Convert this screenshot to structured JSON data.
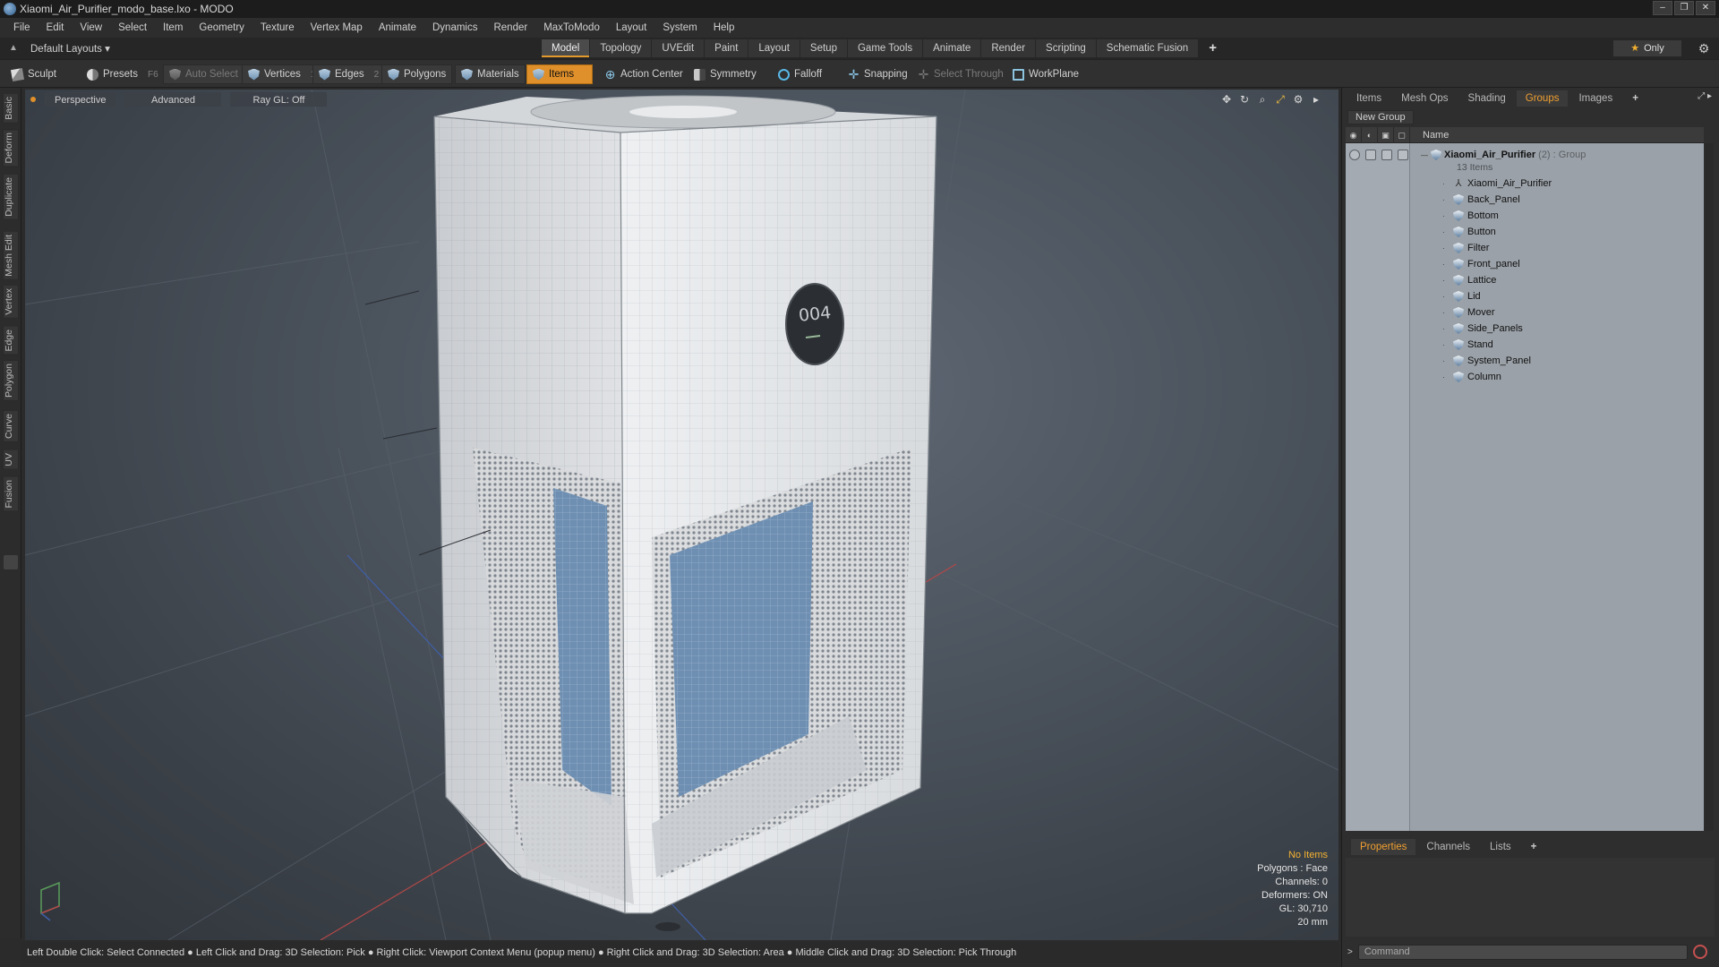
{
  "window": {
    "title": "Xiaomi_Air_Purifier_modo_base.lxo - MODO",
    "controls": [
      "–",
      "❐",
      "✕"
    ]
  },
  "menu": [
    "File",
    "Edit",
    "View",
    "Select",
    "Item",
    "Geometry",
    "Texture",
    "Vertex Map",
    "Animate",
    "Dynamics",
    "Render",
    "MaxToModo",
    "Layout",
    "System",
    "Help"
  ],
  "layout": {
    "selector": "Default Layouts ▾",
    "tabs": [
      "Model",
      "Topology",
      "UVEdit",
      "Paint",
      "Layout",
      "Setup",
      "Game Tools",
      "Animate",
      "Render",
      "Scripting",
      "Schematic Fusion"
    ],
    "active_tab": "Model",
    "plus": "+",
    "only_label": "Only"
  },
  "toolbar": {
    "sculpt": "Sculpt",
    "presets": "Presets",
    "presets_key": "F6",
    "auto_select": "Auto Select",
    "vertices": "Vertices",
    "vertices_key": "1",
    "edges": "Edges",
    "edges_key": "2",
    "polygons": "Polygons",
    "materials": "Materials",
    "items": "Items",
    "action_center": "Action Center",
    "symmetry": "Symmetry",
    "falloff": "Falloff",
    "snapping": "Snapping",
    "select_through": "Select Through",
    "workplane": "WorkPlane"
  },
  "left_tabs": [
    "Basic",
    "Deform",
    "Duplicate",
    "Mesh Edit",
    "Vertex",
    "Edge",
    "Polygon",
    "Curve",
    "UV",
    "Fusion"
  ],
  "viewport": {
    "view": "Perspective",
    "shading": "Advanced",
    "raygl": "Ray GL: Off",
    "display_number": "004",
    "info": {
      "selection": "No Items",
      "polygons": "Polygons : Face",
      "channels": "Channels: 0",
      "deformers": "Deformers: ON",
      "gl": "GL: 30,710",
      "scale": "20 mm"
    }
  },
  "status": "Left Double Click: Select Connected ● Left Click and Drag: 3D Selection: Pick ● Right Click: Viewport Context Menu (popup menu) ● Right Click and Drag: 3D Selection: Area ● Middle Click and Drag: 3D Selection: Pick Through",
  "right_panel": {
    "tabs": [
      "Items",
      "Mesh Ops",
      "Shading",
      "Groups",
      "Images",
      "+"
    ],
    "active_tab": "Groups",
    "new_group": "New Group",
    "column_name": "Name",
    "group": {
      "name": "Xiaomi_Air_Purifier",
      "meta": "(2) : Group",
      "count": "13 Items"
    },
    "items": [
      "Xiaomi_Air_Purifier",
      "Back_Panel",
      "Bottom",
      "Button",
      "Filter",
      "Front_panel",
      "Lattice",
      "Lid",
      "Mover",
      "Side_Panels",
      "Stand",
      "System_Panel",
      "Column"
    ],
    "prop_tabs": [
      "Properties",
      "Channels",
      "Lists",
      "+"
    ],
    "prop_active": "Properties",
    "command_placeholder": "Command"
  },
  "colors": {
    "accent": "#e0902a",
    "info_warn": "#f2b233"
  }
}
